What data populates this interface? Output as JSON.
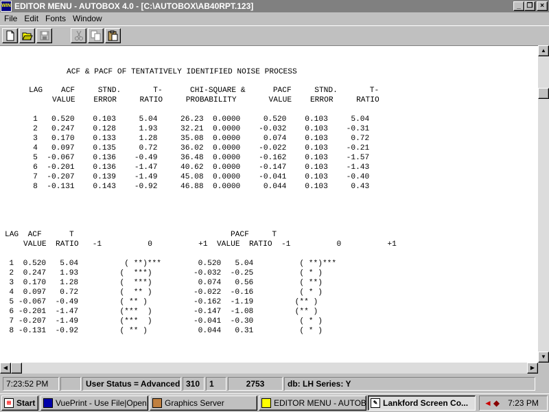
{
  "window": {
    "title": "EDITOR MENU - AUTOBOX 4.0 - [C:\\AUTOBOX\\AB40RPT.123]",
    "icon": "autobox-app-icon",
    "minimize": "_",
    "restore": "❐",
    "close": "×"
  },
  "menu": {
    "file": "File",
    "edit": "Edit",
    "fonts": "Fonts",
    "window": "Window"
  },
  "toolbar": {
    "new_icon": "new-document-icon",
    "open_icon": "open-folder-icon",
    "save_icon": "save-disk-icon",
    "cut_icon": "cut-scissors-icon",
    "copy_icon": "copy-icon",
    "paste_icon": "paste-clipboard-icon"
  },
  "report": {
    "title": "ACF & PACF OF TENTATIVELY IDENTIFIED NOISE PROCESS",
    "table1_header1": "LAG    ACF     STND.       T-      CHI-SQUARE &      PACF     STND.       T-",
    "table1_header2": "VALUE    ERROR     RATIO     PROBABILITY       VALUE    ERROR     RATIO",
    "table1_rows": [
      "   1   0.520    0.103     5.04     26.23  0.0000     0.520    0.103     5.04",
      "   2   0.247    0.128     1.93     32.21  0.0000    -0.032    0.103    -0.31",
      "   3   0.170    0.133     1.28     35.08  0.0000     0.074    0.103     0.72",
      "   4   0.097    0.135     0.72     36.02  0.0000    -0.022    0.103    -0.21",
      "   5  -0.067    0.136    -0.49     36.48  0.0000    -0.162    0.103    -1.57",
      "   6  -0.201    0.136    -1.47     40.62  0.0000    -0.147    0.103    -1.43",
      "   7  -0.207    0.139    -1.49     45.08  0.0000    -0.041    0.103    -0.40",
      "   8  -0.131    0.143    -0.92     46.88  0.0000     0.044    0.103     0.43"
    ],
    "table2_header1": "LAG  ACF      T                                  PACF     T",
    "table2_header2": "VALUE  RATIO   -1          0          +1  VALUE  RATIO  -1          0          +1",
    "table2_rows": [
      "  1  0.520   5.04          ( **)***        0.520   5.04          ( **)***",
      "  2  0.247   1.93         (  ***)         -0.032  -0.25          ( * )",
      "  3  0.170   1.28         (  ***)          0.074   0.56          ( **)",
      "  4  0.097   0.72         (  ** )         -0.022  -0.16          ( * )",
      "  5 -0.067  -0.49         ( ** )          -0.162  -1.19         (** )",
      "  6 -0.201  -1.47         (***  )         -0.147  -1.08         (** )",
      "  7 -0.207  -1.49         (***  )         -0.041  -0.30          ( * )",
      "  8 -0.131  -0.92         ( ** )           0.044   0.31          ( * )"
    ]
  },
  "status": {
    "time": "7:23:52 PM",
    "blank": "",
    "user_status": "User Status = Advanced",
    "col": "310",
    "line": "1",
    "count": "2753",
    "db": "db: LH Series: Y"
  },
  "taskbar": {
    "start": "Start",
    "tasks": [
      "VuePrint - Use File|Open....",
      "Graphics Server",
      "EDITOR MENU - AUTOB...",
      "Lankford Screen Co..."
    ],
    "clock": "7:23 PM"
  }
}
